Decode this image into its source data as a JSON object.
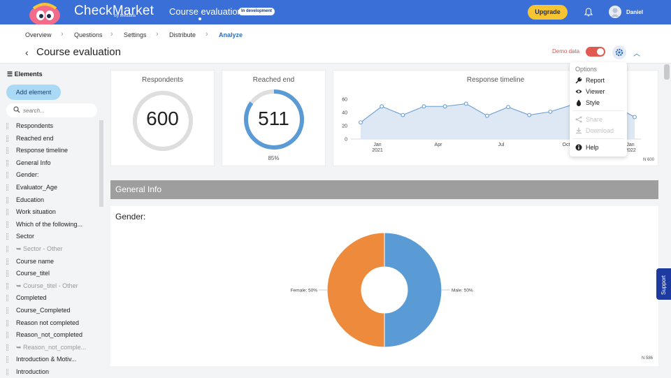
{
  "header": {
    "brand": "CheckMarket",
    "brand_sub": "By Medallia",
    "survey_title": "Course evaluation",
    "status_badge": "In development",
    "upgrade_label": "Upgrade",
    "user_name": "Daniel"
  },
  "breadcrumbs": [
    "Overview",
    "Questions",
    "Settings",
    "Distribute",
    "Analyze"
  ],
  "page": {
    "title": "Course evaluation",
    "demo_label": "Demo data"
  },
  "sidebar": {
    "heading": "Elements",
    "add_label": "Add element",
    "search_placeholder": "search...",
    "items": [
      {
        "label": "Respondents",
        "sub": false
      },
      {
        "label": "Reached end",
        "sub": false
      },
      {
        "label": "Response timeline",
        "sub": false
      },
      {
        "label": "General Info",
        "sub": false
      },
      {
        "label": "Gender:",
        "sub": false
      },
      {
        "label": "Evaluator_Age",
        "sub": false
      },
      {
        "label": "Education",
        "sub": false
      },
      {
        "label": "Work situation",
        "sub": false
      },
      {
        "label": "Which of the following...",
        "sub": false
      },
      {
        "label": "Sector",
        "sub": false
      },
      {
        "label": "Sector - Other",
        "sub": true
      },
      {
        "label": "Course name",
        "sub": false
      },
      {
        "label": "Course_titel",
        "sub": false
      },
      {
        "label": "Course_titel - Other",
        "sub": true
      },
      {
        "label": "Completed",
        "sub": false
      },
      {
        "label": "Course_Completed",
        "sub": false
      },
      {
        "label": "Reason not completed",
        "sub": false
      },
      {
        "label": "Reason_not_completed",
        "sub": false
      },
      {
        "label": "Reason_not_comple...",
        "sub": true
      },
      {
        "label": "Introduction & Motiv...",
        "sub": false
      },
      {
        "label": "Introduction",
        "sub": false
      }
    ]
  },
  "cards": {
    "respondents": {
      "title": "Respondents",
      "value": "600",
      "fraction": 1.0
    },
    "reached_end": {
      "title": "Reached end",
      "value": "511",
      "pct": "85%",
      "fraction": 0.85
    },
    "timeline": {
      "title": "Response timeline",
      "n_label": "N 600"
    }
  },
  "section": {
    "title": "General Info"
  },
  "gender": {
    "title": "Gender:",
    "n_label": "N 586"
  },
  "menu": {
    "heading": "Options",
    "items": [
      {
        "label": "Report",
        "disabled": false,
        "icon": "wrench-icon"
      },
      {
        "label": "Viewer",
        "disabled": false,
        "icon": "eye-icon"
      },
      {
        "label": "Style",
        "disabled": false,
        "icon": "drop-icon"
      },
      {
        "label": "Share",
        "disabled": true,
        "icon": "share-icon"
      },
      {
        "label": "Download",
        "disabled": true,
        "icon": "download-icon"
      },
      {
        "label": "Help",
        "disabled": false,
        "icon": "info-icon"
      }
    ]
  },
  "support_label": "Support",
  "colors": {
    "accent": "#3a6fd8",
    "ring_blue": "#5b9bd5",
    "female": "#ed8a3c",
    "male": "#5b9bd5",
    "toggle": "#e05a4f"
  },
  "chart_data": [
    {
      "type": "line",
      "title": "Response timeline",
      "x_tick_labels": [
        "Jan 2021",
        "Apr",
        "Jul",
        "Oct",
        "Jan 2022"
      ],
      "y_ticks": [
        0,
        20,
        40,
        60
      ],
      "ylim": [
        0,
        65
      ],
      "series": [
        {
          "values": [
            25,
            49,
            36,
            49,
            49,
            53,
            35,
            48,
            36,
            41,
            51,
            49,
            50,
            33
          ]
        }
      ]
    },
    {
      "type": "pie",
      "title": "Gender:",
      "categories": [
        "Male: 50%",
        "Female: 50%"
      ],
      "values": [
        50,
        50
      ]
    }
  ]
}
